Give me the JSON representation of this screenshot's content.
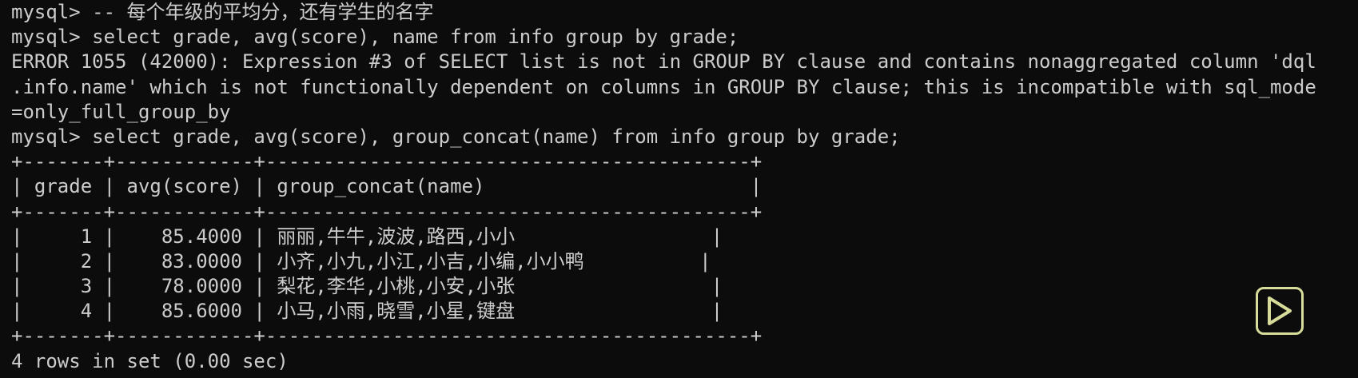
{
  "terminal": {
    "lines": [
      "mysql> -- 每个年级的平均分，还有学生的名字",
      "mysql> select grade, avg(score), name from info group by grade;",
      "ERROR 1055 (42000): Expression #3 of SELECT list is not in GROUP BY clause and contains nonaggregated column 'dql",
      ".info.name' which is not functionally dependent on columns in GROUP BY clause; this is incompatible with sql_mode",
      "=only_full_group_by",
      "mysql> select grade, avg(score), group_concat(name) from info group by grade;",
      "+-------+------------+------------------------------------------+",
      "| grade | avg(score) | group_concat(name)                       |",
      "+-------+------------+------------------------------------------+",
      "|     1 |    85.4000 | 丽丽,牛牛,波波,路西,小小                 |",
      "|     2 |    83.0000 | 小齐,小九,小江,小吉,小编,小小鸭          |",
      "|     3 |    78.0000 | 梨花,李华,小桃,小安,小张                 |",
      "|     4 |    85.6000 | 小马,小雨,晓雪,小星,键盘                 |",
      "+-------+------------+------------------------------------------+",
      "4 rows in set (0.00 sec)"
    ]
  },
  "overlay": {
    "icon": "play-icon",
    "color": "#d8dc9a"
  }
}
